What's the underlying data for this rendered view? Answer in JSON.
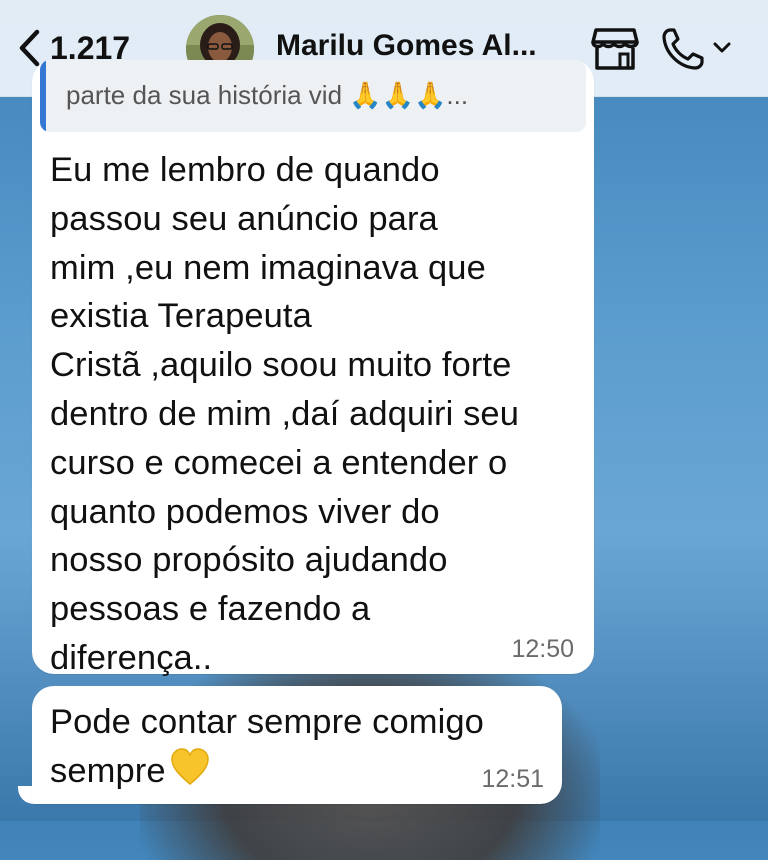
{
  "header": {
    "back_count": "1.217",
    "contact_name": "Marilu Gomes Al...",
    "icons": [
      "chevron-left-icon",
      "store-icon",
      "phone-icon",
      "chevron-down-icon"
    ]
  },
  "messages": [
    {
      "quoted_text": "parte da sua história vid 🙏🙏🙏...",
      "text": "Eu me lembro de quando\npassou seu anúncio para\nmim ,eu nem imaginava que\nexistia Terapeuta\nCristã ,aquilo soou muito forte\ndentro de mim ,daí adquiri seu\ncurso e comecei a entender o\nquanto podemos viver do\nnosso propósito ajudando\npessoas e fazendo a\ndiferença..",
      "time": "12:50"
    },
    {
      "text": "Pode contar sempre comigo\nsempre",
      "emoji": "yellow-heart",
      "time": "12:51"
    }
  ],
  "colors": {
    "header_bg": "#e8f0f8",
    "quote_bar": "#3478d4",
    "bubble_bg": "#ffffff",
    "heart": "#f7c52b"
  }
}
